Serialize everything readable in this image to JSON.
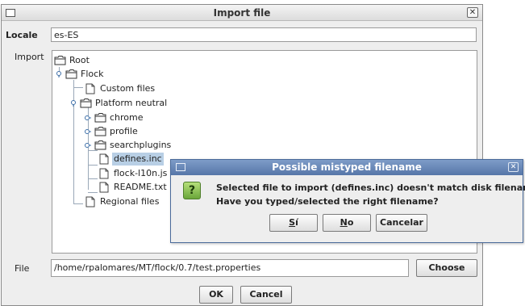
{
  "window": {
    "title": "Import file"
  },
  "locale": {
    "label": "Locale",
    "value": "es-ES"
  },
  "import": {
    "label": "Import",
    "tree": {
      "root": "Root",
      "flock": "Flock",
      "custom_files": "Custom files",
      "platform_neutral": "Platform neutral",
      "chrome": "chrome",
      "profile": "profile",
      "searchplugins": "searchplugins",
      "defines_inc": "defines.inc",
      "flock_l10n": "flock-l10n.js",
      "readme": "README.txt",
      "regional_files": "Regional files"
    }
  },
  "file": {
    "label": "File",
    "value": "/home/rpalomares/MT/flock/0.7/test.properties",
    "choose": "Choose"
  },
  "buttons": {
    "ok": "OK",
    "cancel": "Cancel"
  },
  "dialog": {
    "title": "Possible mistyped filename",
    "line1": "Selected file to import (defines.inc) doesn't match disk filename.",
    "line2": "Have you typed/selected the right filename?",
    "yes_mnemonic": "S",
    "yes_rest": "í",
    "no_mnemonic": "N",
    "no_rest": "o",
    "cancel": "Cancelar"
  },
  "icons": {
    "folder": "folder-icon",
    "file": "file-icon",
    "question": "question-icon",
    "tree_toggle": "tree-toggle-icon"
  },
  "colors": {
    "dialog_titlebar": "#5676a8",
    "selection": "#b8cfe5",
    "question_icon": "#6aa63a"
  }
}
